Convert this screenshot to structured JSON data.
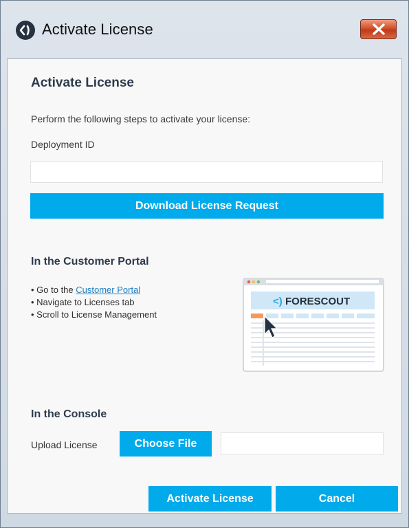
{
  "window": {
    "title": "Activate License",
    "close_label": "X"
  },
  "dialog": {
    "heading": "Activate License",
    "intro": "Perform the following steps to activate your license:",
    "deployment_label": "Deployment ID",
    "deployment_value": "",
    "download_button": "Download License Request"
  },
  "portal": {
    "heading": "In the Customer Portal",
    "step1_prefix": "• Go to the ",
    "step1_link": "Customer Portal",
    "step2": "• Navigate to Licenses tab",
    "step3": "• Scroll to License Management",
    "illustration_brand": "FORESCOUT",
    "illustration_logo_mark": "<)"
  },
  "console": {
    "heading": "In the Console",
    "upload_label": "Upload License",
    "choose_button": "Choose File",
    "file_name": ""
  },
  "actions": {
    "activate_button": "Activate License",
    "cancel_button": "Cancel"
  },
  "colors": {
    "accent": "#00aaeb",
    "heading": "#2e3b4c",
    "link": "#1f7fc2",
    "close_button": "#c8452a"
  }
}
